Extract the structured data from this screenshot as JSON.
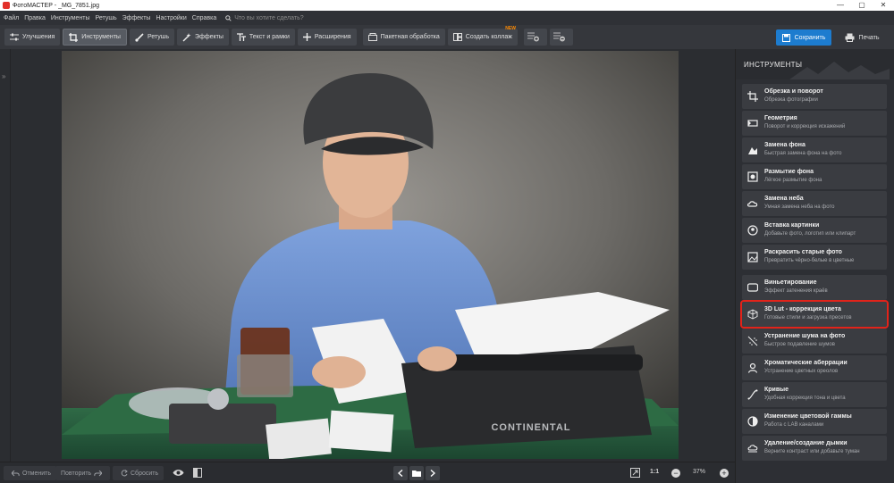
{
  "titlebar": {
    "title": "ФотоМАСТЕР - _MG_7851.jpg",
    "minimize": "—",
    "maximize": "▢",
    "close": "✕"
  },
  "menu": {
    "items": [
      "Файл",
      "Правка",
      "Инструменты",
      "Ретушь",
      "Эффекты",
      "Настройки",
      "Справка"
    ],
    "search_placeholder": "Что вы хотите сделать?"
  },
  "toolbar": {
    "tabs": [
      {
        "label": "Улучшения",
        "icon": "sliders-icon"
      },
      {
        "label": "Инструменты",
        "icon": "crop-icon",
        "active": true
      },
      {
        "label": "Ретушь",
        "icon": "brush-icon"
      },
      {
        "label": "Эффекты",
        "icon": "magic-wand-icon"
      },
      {
        "label": "Текст и рамки",
        "icon": "text-icon"
      },
      {
        "label": "Расширения",
        "icon": "plus-icon"
      }
    ],
    "batch_label": "Пакетная обработка",
    "collage_label": "Создать коллаж",
    "collage_badge": "NEW",
    "save_label": "Сохранить",
    "print_label": "Печать"
  },
  "panel": {
    "title": "ИНСТРУМЕНТЫ",
    "tools": [
      {
        "name": "Обрезка и поворот",
        "desc": "Обрезка фотографии",
        "icon": "crop-rotate-icon"
      },
      {
        "name": "Геометрия",
        "desc": "Поворот и коррекция искажений",
        "icon": "geometry-icon"
      },
      {
        "name": "Замена фона",
        "desc": "Быстрая замена фона на фото",
        "icon": "background-replace-icon"
      },
      {
        "name": "Размытие фона",
        "desc": "Лёгкое размытие фона",
        "icon": "blur-icon"
      },
      {
        "name": "Замена неба",
        "desc": "Умная замена неба на фото",
        "icon": "sky-icon"
      },
      {
        "name": "Вставка картинки",
        "desc": "Добавьте фото, логотип или клипарт",
        "icon": "insert-image-icon"
      },
      {
        "name": "Раскрасить старые фото",
        "desc": "Превратить чёрно-белые в цветные",
        "icon": "colorize-icon"
      },
      {
        "name": "Виньетирование",
        "desc": "Эффект затенения краёв",
        "icon": "vignette-icon"
      },
      {
        "name": "3D Lut - коррекция цвета",
        "desc": "Готовые стили и загрузка пресетов",
        "icon": "cube-icon"
      },
      {
        "name": "Устранение шума на фото",
        "desc": "Быстрое подавление шумов",
        "icon": "noise-icon"
      },
      {
        "name": "Хроматические аберрации",
        "desc": "Устранение цветных ореолов",
        "icon": "aberration-icon"
      },
      {
        "name": "Кривые",
        "desc": "Удобная коррекция тона и цвета",
        "icon": "curves-icon"
      },
      {
        "name": "Изменение цветовой гаммы",
        "desc": "Работа с LAB каналами",
        "icon": "color-gamut-icon"
      },
      {
        "name": "Удаление/создание дымки",
        "desc": "Верните контраст или добавьте туман",
        "icon": "haze-icon"
      }
    ]
  },
  "bottombar": {
    "undo_label": "Отменить",
    "redo_label": "Повторить",
    "reset_label": "Сбросить",
    "zoom_ratio": "1:1",
    "zoom_percent": "37%",
    "zoom_minus": "−",
    "zoom_plus": "+"
  },
  "photo": {
    "typewriter_brand": "CONTINENTAL"
  },
  "colors": {
    "accent": "#1d7ccf",
    "highlight": "#e2231a",
    "badge": "#ff8a00"
  }
}
